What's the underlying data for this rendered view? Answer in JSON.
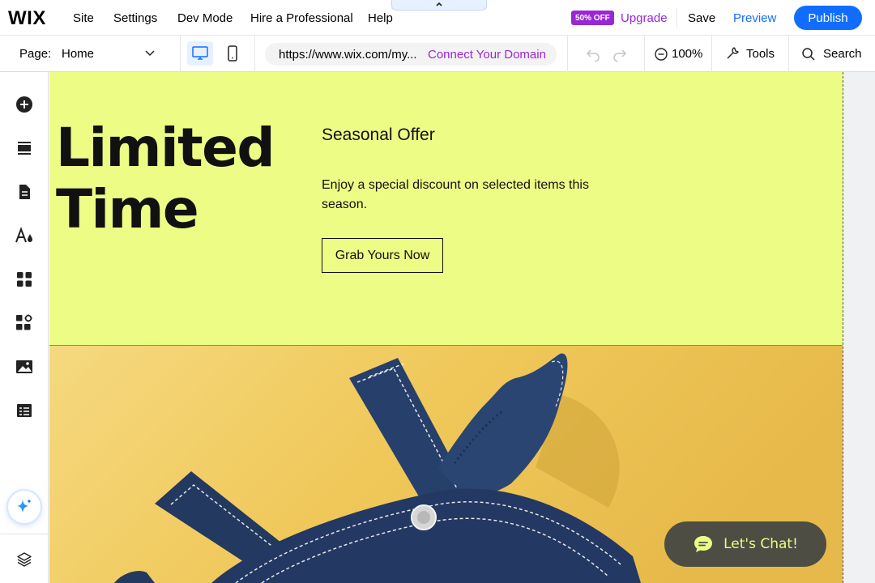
{
  "topbar": {
    "logo": "WIX",
    "nav": [
      "Site",
      "Settings",
      "Dev Mode",
      "Hire a Professional",
      "Help"
    ],
    "badge": "50% OFF",
    "upgrade": "Upgrade",
    "save": "Save",
    "preview": "Preview",
    "publish": "Publish"
  },
  "subbar": {
    "page_label": "Page:",
    "page_value": "Home",
    "url": "https://www.wix.com/my...",
    "connect": "Connect Your Domain",
    "zoom": "100%",
    "tools": "Tools",
    "search": "Search"
  },
  "leftbar": {
    "icons": [
      "add-icon",
      "sections-icon",
      "pages-icon",
      "theme-icon",
      "apps-icon",
      "business-apps-icon",
      "media-icon",
      "cms-icon",
      "ai-assistant-icon",
      "layers-icon"
    ]
  },
  "canvas": {
    "title_line1": "Limited",
    "title_line2": "Time",
    "subhead": "Seasonal Offer",
    "body": "Enjoy a special discount on selected items this season.",
    "cta": "Grab Yours Now",
    "chat": "Let's Chat!"
  },
  "colors": {
    "hero_bg": "#ecfc85",
    "accent_blue": "#116dff",
    "accent_purple": "#9a27d5",
    "photo_bg": "#f0c85a",
    "garment": "#243a63",
    "chat_bg": "#4d4d44"
  }
}
